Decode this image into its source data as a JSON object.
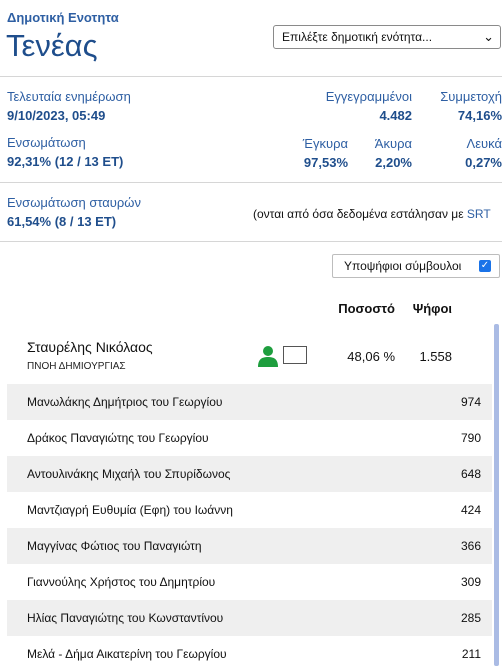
{
  "header": {
    "section_label": "Δημοτική Ενοτητα",
    "municipality": "Τενέας",
    "select_value": "Επιλέξτε δημοτική ενότητα..."
  },
  "stats": {
    "last_update_label": "Τελευταία ενημέρωση",
    "last_update_value": "9/10/2023, 05:49",
    "registered_label": "Εγγεγραμμένοι",
    "registered_value": "4.482",
    "turnout_label": "Συμμετοχή",
    "turnout_value": "74,16%",
    "integration_label": "Ενσωμάτωση",
    "integration_value": "92,31% (12 / 13 ΕΤ)",
    "valid_label": "Έγκυρα",
    "valid_value": "97,53%",
    "invalid_label": "Άκυρα",
    "invalid_value": "2,20%",
    "blank_label": "Λευκά",
    "blank_value": "0,27%",
    "cross_integration_label": "Ενσωμάτωση σταυρών",
    "cross_integration_value": "61,54% (8 / 13 ΕΤ)",
    "note_text": "(ονται από όσα δεδομένα εστάλησαν με ",
    "note_link": "SRT"
  },
  "toggle": {
    "label": "Υποψήφιοι σύμβουλοι",
    "checked": true
  },
  "table": {
    "col_percent": "Ποσοστό",
    "col_votes": "Ψήφοι",
    "candidate": {
      "name": "Σταυρέλης Νικόλαος",
      "party": "ΠΝΟΗ ΔΗΜΙΟΥΡΓΙΑΣ",
      "percent": "48,06 %",
      "votes": "1.558"
    },
    "rows": [
      {
        "name": "Μανωλάκης Δημήτριος του Γεωργίου",
        "votes": "974"
      },
      {
        "name": "Δράκος Παναγιώτης του Γεωργίου",
        "votes": "790"
      },
      {
        "name": "Αντουλινάκης Μιχαήλ του Σπυρίδωνος",
        "votes": "648"
      },
      {
        "name": "Μαντζιαγρή Ευθυμία (Εφη) του Ιωάννη",
        "votes": "424"
      },
      {
        "name": "Μαγγίνας Φώτιος του Παναγιώτη",
        "votes": "366"
      },
      {
        "name": "Γιαννούλης Χρήστος του Δημητρίου",
        "votes": "309"
      },
      {
        "name": "Ηλίας Παναγιώτης του Κωνσταντίνου",
        "votes": "285"
      },
      {
        "name": "Μελά - Δήμα Αικατερίνη του Γεωργίου",
        "votes": "211"
      }
    ]
  },
  "colors": {
    "accent": "#2e5fa3",
    "accent_dark": "#1f4e8c",
    "row_shade": "#efefef",
    "checkbox": "#1a73e8",
    "person_icon": "#1e9e3e",
    "scrollbar": "#aabbe4"
  },
  "icons": {
    "person": "person-icon",
    "chevron": "chevron-down-icon",
    "check": "check-icon"
  }
}
